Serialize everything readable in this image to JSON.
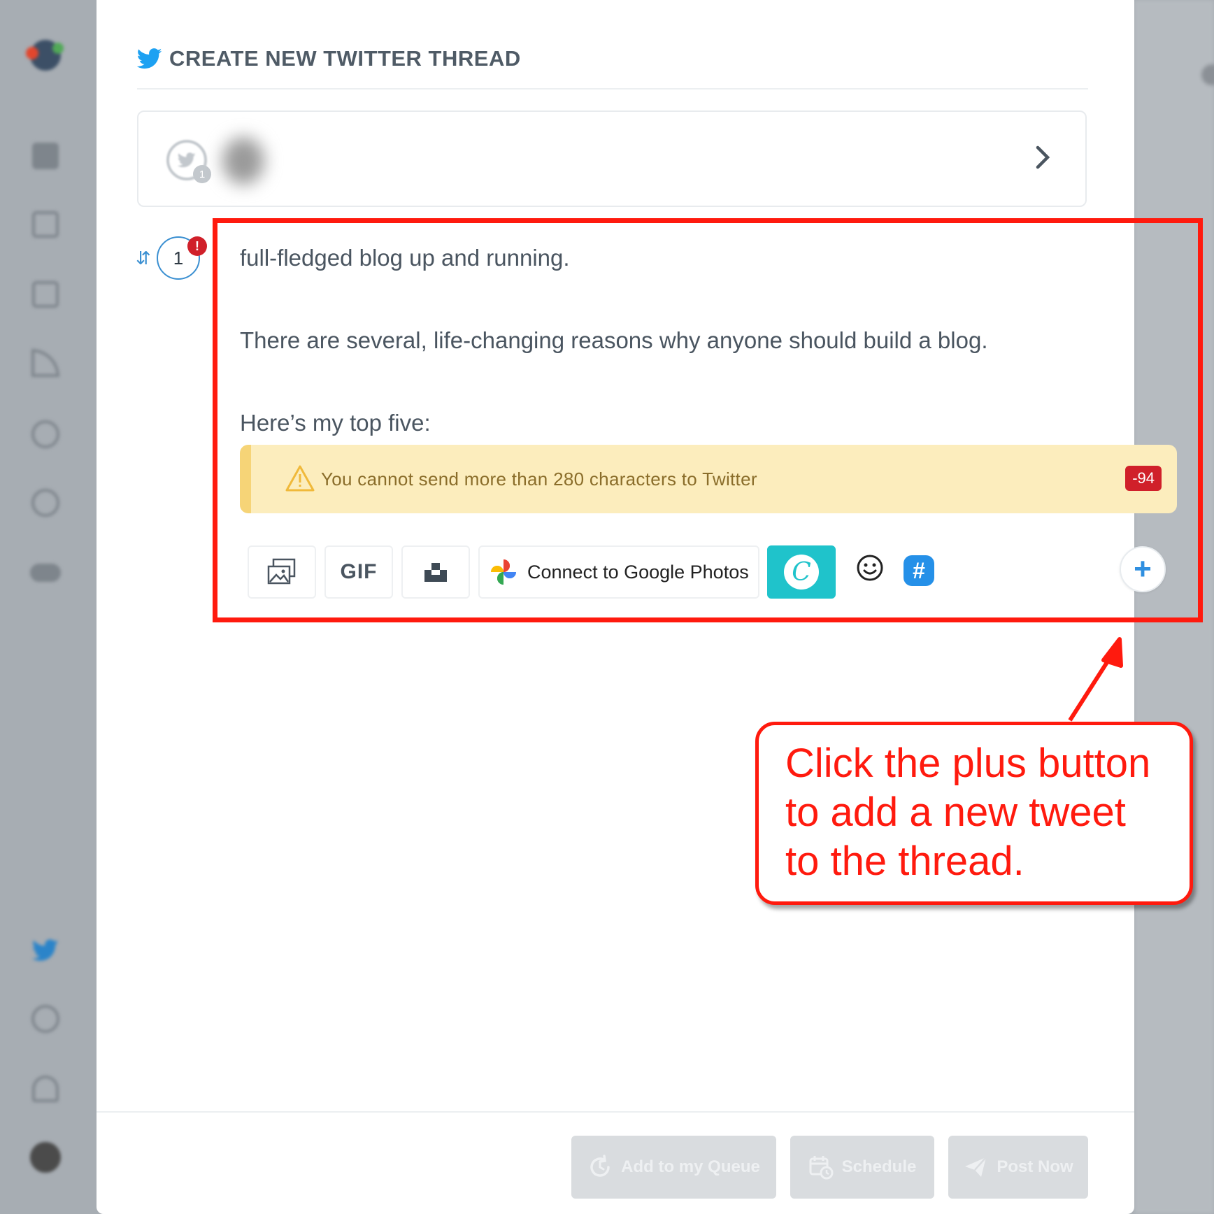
{
  "page": {
    "title": "CREATE NEW TWITTER THREAD"
  },
  "account": {
    "badge_count": "1"
  },
  "tweet": {
    "number": "1",
    "error_marker": "!",
    "paragraphs": [
      "full-fledged blog up and running.",
      "There are several, life-changing reasons why anyone should build a blog.",
      "Here’s my top five:"
    ]
  },
  "warning": {
    "message": "You cannot send more than 280 characters to Twitter",
    "count": "-94"
  },
  "toolbar": {
    "gif_label": "GIF",
    "google_photos_label": "Connect to Google Photos",
    "plus_label": "+",
    "hash_label": "#"
  },
  "footer": {
    "queue_label": "Add to my Queue",
    "schedule_label": "Schedule",
    "post_label": "Post Now"
  },
  "callout": {
    "lines": [
      "Click the plus button",
      "to add a new tweet",
      "to the thread."
    ]
  },
  "colors": {
    "twitter_blue": "#1da1f2",
    "annotation_red": "#ff1a0e",
    "warning_bg": "#fcedbd",
    "error_red": "#d0202a",
    "canva_teal": "#1fc3cb"
  },
  "icons": {
    "sidebar": [
      "logo-icon",
      "dashboard-icon",
      "compose-icon",
      "calendar-icon",
      "rss-icon",
      "analytics-icon",
      "bulb-icon",
      "toggle-icon",
      "twitter-icon",
      "info-icon",
      "bell-icon",
      "avatar"
    ],
    "toolbar": [
      "image-gallery-icon",
      "gif-icon",
      "unsplash-icon",
      "google-photos-icon",
      "canva-icon",
      "emoji-icon",
      "hashtag-icon",
      "plus-icon"
    ]
  }
}
